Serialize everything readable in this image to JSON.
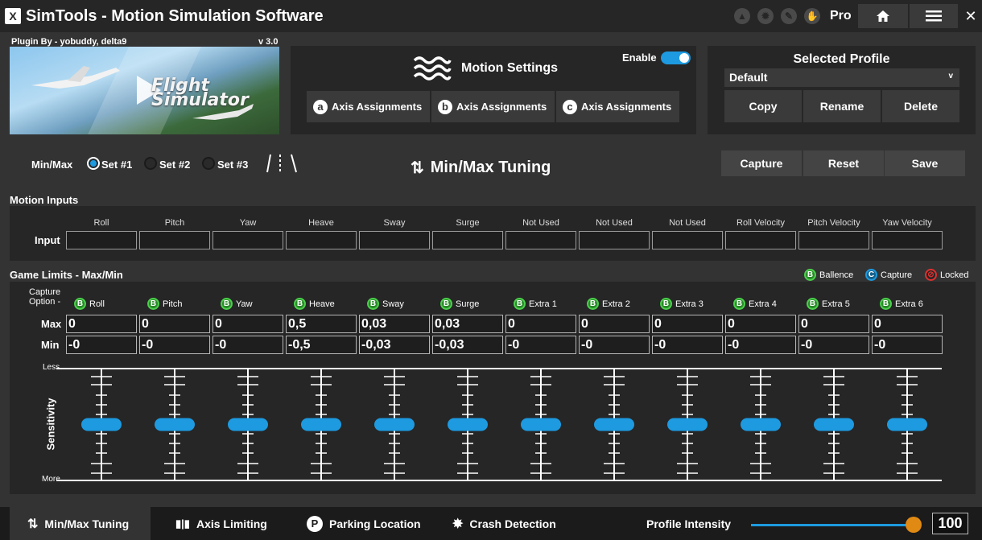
{
  "app": {
    "logo_text": "X",
    "title": "SimTools - Motion Simulation Software",
    "edition": "Pro"
  },
  "titlebar_icons": [
    "up-arrow-icon",
    "gear-icon",
    "wrench-icon",
    "hand-icon"
  ],
  "titlebar_buttons": [
    "home-icon",
    "menu-icon",
    "close-icon"
  ],
  "plugin": {
    "by": "Plugin By - yobuddy, delta9",
    "version": "v 3.0",
    "image_text": "Flight Simulator"
  },
  "motion_settings": {
    "title": "Motion Settings",
    "enable_label": "Enable",
    "enabled": true,
    "axis_buttons": [
      {
        "badge": "a",
        "label": "Axis Assignments"
      },
      {
        "badge": "b",
        "label": "Axis Assignments"
      },
      {
        "badge": "c",
        "label": "Axis Assignments"
      }
    ]
  },
  "profile": {
    "title": "Selected Profile",
    "selected": "Default",
    "chevron": "v",
    "buttons": [
      "Copy",
      "Rename",
      "Delete"
    ]
  },
  "minmax": {
    "label": "Min/Max",
    "sets": [
      "Set #1",
      "Set #2",
      "Set #3"
    ],
    "selected_set": 0,
    "title": "Min/Max Tuning",
    "buttons": [
      "Capture",
      "Reset",
      "Save"
    ]
  },
  "motion_inputs": {
    "title": "Motion Inputs",
    "row_label": "Input",
    "columns": [
      "Roll",
      "Pitch",
      "Yaw",
      "Heave",
      "Sway",
      "Surge",
      "Not Used",
      "Not Used",
      "Not Used",
      "Roll Velocity",
      "Pitch Velocity",
      "Yaw Velocity"
    ],
    "values": [
      "",
      "",
      "",
      "",
      "",
      "",
      "",
      "",
      "",
      "",
      "",
      ""
    ]
  },
  "game_limits": {
    "title": "Game Limits - Max/Min",
    "legend": [
      {
        "badge": "B",
        "label": "Ballence",
        "color": "#4cd04c"
      },
      {
        "badge": "C",
        "label": "Capture",
        "color": "#1d9ae0"
      },
      {
        "badge": "",
        "label": "Locked",
        "color": "#e03030"
      }
    ],
    "capture_option_label": "Capture\nOption -",
    "option_badge": "B",
    "columns": [
      "Roll",
      "Pitch",
      "Yaw",
      "Heave",
      "Sway",
      "Surge",
      "Extra 1",
      "Extra 2",
      "Extra 3",
      "Extra 4",
      "Extra 5",
      "Extra 6"
    ],
    "max_label": "Max",
    "min_label": "Min",
    "max": [
      "0",
      "0",
      "0",
      "0,5",
      "0,03",
      "0,03",
      "0",
      "0",
      "0",
      "0",
      "0",
      "0"
    ],
    "min": [
      "-0",
      "-0",
      "-0",
      "-0,5",
      "-0,03",
      "-0,03",
      "-0",
      "-0",
      "-0",
      "-0",
      "-0",
      "-0"
    ],
    "sensitivity_label": "Sensitivity",
    "less_label": "Less",
    "more_label": "More",
    "sensitivity_levels": [
      0.5,
      0.5,
      0.5,
      0.5,
      0.5,
      0.5,
      0.5,
      0.5,
      0.5,
      0.5,
      0.5,
      0.5
    ]
  },
  "bottom_tabs": [
    {
      "icon": "⇅",
      "label": "Min/Max Tuning",
      "active": true
    },
    {
      "icon": "▮|▮",
      "label": "Axis Limiting",
      "active": false
    },
    {
      "icon": "P",
      "label": "Parking Location",
      "active": false
    },
    {
      "icon": "✸",
      "label": "Crash Detection",
      "active": false
    }
  ],
  "intensity": {
    "label": "Profile Intensity",
    "value": "100",
    "level": 1.0
  },
  "colors": {
    "accent": "#1d9ae0",
    "knob": "#e08a14",
    "background": "#262626",
    "panel": "#333333"
  }
}
